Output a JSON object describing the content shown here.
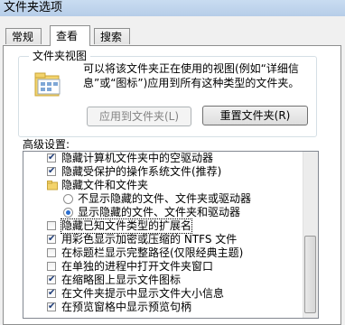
{
  "window": {
    "title": "文件夹选项"
  },
  "tabs": [
    {
      "label": "常规"
    },
    {
      "label": "查看"
    },
    {
      "label": "搜索"
    }
  ],
  "folder_views": {
    "title": "文件夹视图",
    "description_line1": "可以将该文件夹正在使用的视图(例如“详细信",
    "description_line2": "息”或“图标”)应用到所有这种类型的文件夹。",
    "apply_button": "应用到文件夹(L)",
    "reset_button": "重置文件夹(R)"
  },
  "advanced": {
    "label": "高级设置:",
    "items": [
      {
        "label": "隐藏计算机文件夹中的空驱动器",
        "type": "checkbox",
        "checked": true
      },
      {
        "label": "隐藏受保护的操作系统文件(推荐)",
        "type": "checkbox",
        "checked": true
      },
      {
        "label": "隐藏文件和文件夹",
        "type": "folder"
      },
      {
        "label": "不显示隐藏的文件、文件夹或驱动器",
        "type": "radio",
        "checked": false
      },
      {
        "label": "显示隐藏的文件、文件夹和驱动器",
        "type": "radio",
        "checked": true
      },
      {
        "label": "隐藏已知文件类型的扩展名",
        "type": "checkbox",
        "checked": false,
        "selected": true
      },
      {
        "label": "用彩色显示加密或压缩的 NTFS 文件",
        "type": "checkbox",
        "checked": true
      },
      {
        "label": "在标题栏显示完整路径(仅限经典主题)",
        "type": "checkbox",
        "checked": false
      },
      {
        "label": "在单独的进程中打开文件夹窗口",
        "type": "checkbox",
        "checked": false
      },
      {
        "label": "在缩略图上显示文件图标",
        "type": "checkbox",
        "checked": true
      },
      {
        "label": "在文件夹提示中显示文件大小信息",
        "type": "checkbox",
        "checked": true
      },
      {
        "label": "在预览窗格中显示预览句柄",
        "type": "checkbox",
        "checked": true
      }
    ]
  },
  "colors": {
    "accent": "#2a6ed0",
    "check": "#1f3d7a"
  }
}
